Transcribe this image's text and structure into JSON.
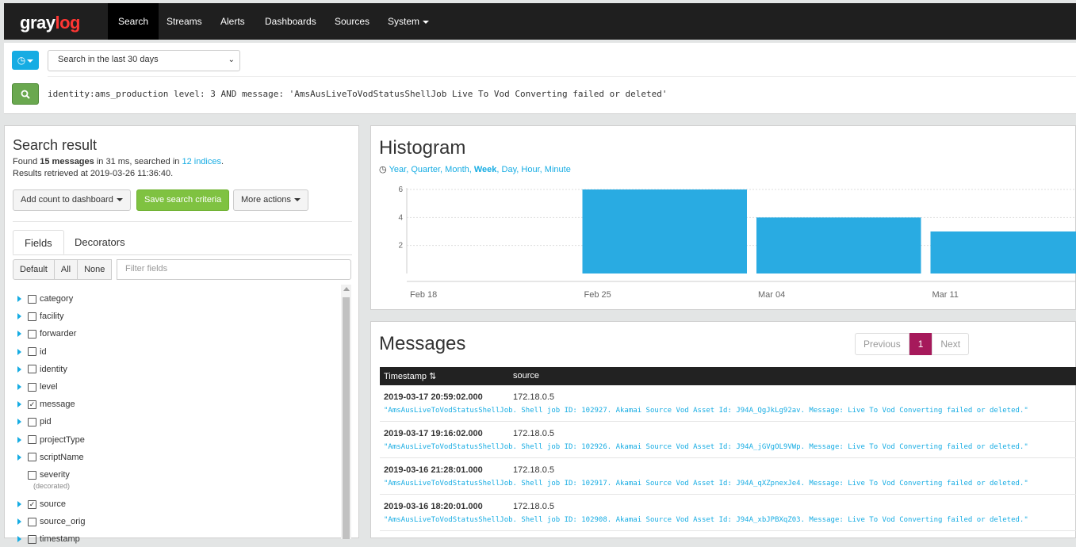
{
  "nav": {
    "logo_main": "gray",
    "logo_accent": "log",
    "items": [
      {
        "label": "Search",
        "active": true
      },
      {
        "label": "Streams"
      },
      {
        "label": "Alerts"
      },
      {
        "label": "Dashboards"
      },
      {
        "label": "Sources"
      },
      {
        "label": "System"
      }
    ]
  },
  "search": {
    "range_value": "Search in the last 30 days",
    "query": "identity:ams_production level: 3 AND message: 'AmsAusLiveToVodStatusShellJob Live To Vod Converting failed or deleted'"
  },
  "result": {
    "title": "Search result",
    "found_prefix": "Found",
    "found_count": "15 messages",
    "found_mid": "in 31 ms, searched in",
    "indices": "12 indices",
    "period": ".",
    "retrieved": "Results retrieved at 2019-03-26 11:36:40.",
    "add_count": "Add count to dashboard",
    "save_criteria": "Save search criteria",
    "more_actions": "More actions",
    "tabs": [
      "Fields",
      "Decorators"
    ],
    "filter_buttons": [
      "Default",
      "All",
      "None"
    ],
    "filter_placeholder": "Filter fields",
    "fields": [
      {
        "name": "category",
        "checked": false,
        "expandable": true
      },
      {
        "name": "facility",
        "checked": false,
        "expandable": true
      },
      {
        "name": "forwarder",
        "checked": false,
        "expandable": true
      },
      {
        "name": "id",
        "checked": false,
        "expandable": true
      },
      {
        "name": "identity",
        "checked": false,
        "expandable": true
      },
      {
        "name": "level",
        "checked": false,
        "expandable": true
      },
      {
        "name": "message",
        "checked": true,
        "expandable": true
      },
      {
        "name": "pid",
        "checked": false,
        "expandable": true
      },
      {
        "name": "projectType",
        "checked": false,
        "expandable": true
      },
      {
        "name": "scriptName",
        "checked": false,
        "expandable": true
      },
      {
        "name": "severity",
        "checked": false,
        "expandable": false,
        "note": "(decorated)"
      },
      {
        "name": "source",
        "checked": true,
        "expandable": true
      },
      {
        "name": "source_orig",
        "checked": false,
        "expandable": true
      },
      {
        "name": "timestamp",
        "checked": false,
        "expandable": true
      }
    ]
  },
  "histogram": {
    "title": "Histogram",
    "resolutions": [
      "Year",
      "Quarter",
      "Month",
      "Week",
      "Day",
      "Hour",
      "Minute"
    ],
    "active_resolution": "Week",
    "bar_color": "#29abe2"
  },
  "chart_data": {
    "type": "bar",
    "categories": [
      "Feb 18",
      "Feb 25",
      "Mar 04",
      "Mar 11"
    ],
    "values": [
      0,
      6,
      4,
      3
    ],
    "yticks": [
      "2",
      "4",
      "6"
    ],
    "ylim": [
      0,
      6
    ],
    "grid": true
  },
  "messages": {
    "title": "Messages",
    "pager": {
      "previous": "Previous",
      "current": "1",
      "next": "Next"
    },
    "columns": [
      "Timestamp",
      "source"
    ],
    "rows": [
      {
        "timestamp": "2019-03-17 20:59:02.000",
        "source": "172.18.0.5",
        "message": "\"AmsAusLiveToVodStatusShellJob. Shell job ID: 102927. Akamai Source Vod Asset Id: J94A_QgJkLg92av. Message: Live To Vod Converting failed or deleted.\""
      },
      {
        "timestamp": "2019-03-17 19:16:02.000",
        "source": "172.18.0.5",
        "message": "\"AmsAusLiveToVodStatusShellJob. Shell job ID: 102926. Akamai Source Vod Asset Id: J94A_jGVgOL9VWp. Message: Live To Vod Converting failed or deleted.\""
      },
      {
        "timestamp": "2019-03-16 21:28:01.000",
        "source": "172.18.0.5",
        "message": "\"AmsAusLiveToVodStatusShellJob. Shell job ID: 102917. Akamai Source Vod Asset Id: J94A_qXZpnexJe4. Message: Live To Vod Converting failed or deleted.\""
      },
      {
        "timestamp": "2019-03-16 18:20:01.000",
        "source": "172.18.0.5",
        "message": "\"AmsAusLiveToVodStatusShellJob. Shell job ID: 102908. Akamai Source Vod Asset Id: J94A_xbJPBXqZ03. Message: Live To Vod Converting failed or deleted.\""
      }
    ]
  }
}
